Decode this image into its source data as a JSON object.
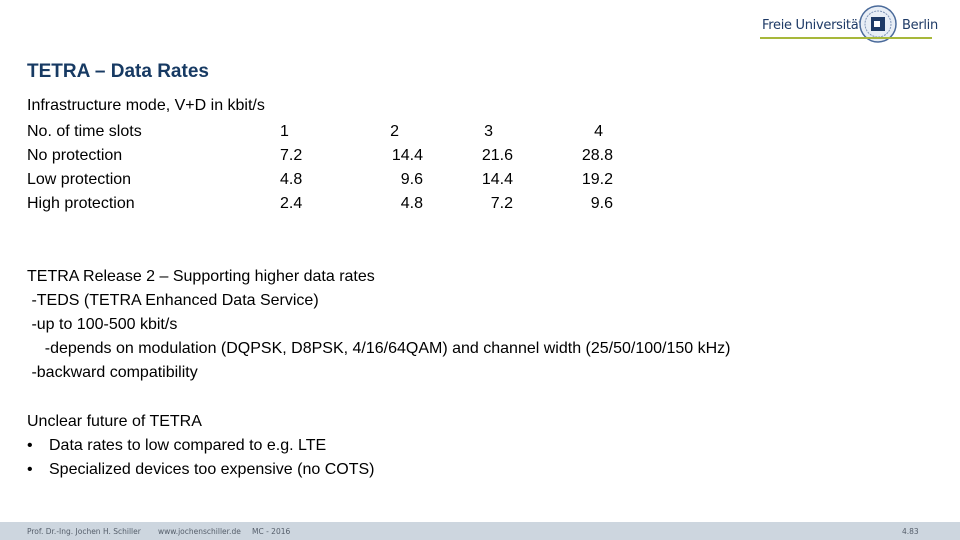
{
  "logo": {
    "left_text": "Freie Universität",
    "right_text": "Berlin",
    "seal_icon": "university-seal-icon",
    "accent_color": "#a7b83a"
  },
  "title": "TETRA – Data Rates",
  "rates_table": {
    "caption": "Infrastructure mode, V+D in kbit/s",
    "header": {
      "label": "No. of time slots",
      "values": [
        "1",
        "2",
        "3",
        "4"
      ]
    },
    "rows": [
      {
        "label": "No protection",
        "values": [
          "7.2",
          "14.4",
          "21.6",
          "28.8"
        ]
      },
      {
        "label": "Low protection",
        "values": [
          "4.8",
          "9.6",
          "14.4",
          "19.2"
        ]
      },
      {
        "label": "High protection",
        "values": [
          "2.4",
          "4.8",
          "7.2",
          "9.6"
        ]
      }
    ]
  },
  "release2": {
    "heading": "TETRA Release 2 – Supporting higher data rates",
    "lines": [
      " -TEDS (TETRA Enhanced Data Service)",
      " -up to 100-500 kbit/s",
      "    -depends on modulation (DQPSK, D8PSK, 4/16/64QAM) and channel width (25/50/100/150 kHz)",
      " -backward compatibility"
    ]
  },
  "future": {
    "heading": "Unclear future of TETRA",
    "bullets": [
      "Data rates to low compared to e.g. LTE",
      "Specialized devices too expensive (no COTS)"
    ]
  },
  "footer": {
    "author": "Prof. Dr.-Ing. Jochen H. Schiller",
    "website": "www.jochenschiller.de",
    "course": "MC - 2016",
    "page": "4.83"
  },
  "colors": {
    "title": "#173a63",
    "footer_bg": "#cdd6df"
  }
}
